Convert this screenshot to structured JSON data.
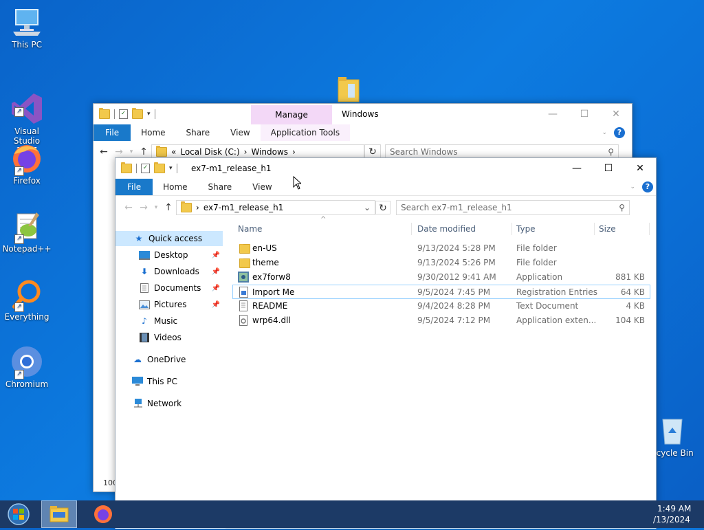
{
  "desktop": {
    "icons": [
      {
        "label": "This PC",
        "icon": "this-pc-icon"
      },
      {
        "label": "Visual Studio\n2017",
        "icon": "visual-studio-icon"
      },
      {
        "label": "Firefox",
        "icon": "firefox-icon"
      },
      {
        "label": "Notepad++",
        "icon": "notepad-plus-plus-icon"
      },
      {
        "label": "Everything",
        "icon": "everything-icon"
      },
      {
        "label": "Chromium",
        "icon": "chromium-icon"
      },
      {
        "label": "ecycle Bin",
        "icon": "recycle-bin-icon"
      }
    ]
  },
  "back_window": {
    "title": "Windows",
    "contextual_tab_group": "Manage",
    "tabs": [
      "File",
      "Home",
      "Share",
      "View",
      "Application Tools"
    ],
    "breadcrumb": {
      "prefix": "«",
      "items": [
        "Local Disk (C:)",
        "Windows"
      ]
    },
    "search_placeholder": "Search Windows",
    "status_fragment": "100"
  },
  "front_window": {
    "title": "ex7-m1_release_h1",
    "tabs": [
      "File",
      "Home",
      "Share",
      "View"
    ],
    "breadcrumb": {
      "items": [
        "ex7-m1_release_h1"
      ]
    },
    "search_placeholder": "Search ex7-m1_release_h1",
    "nav": {
      "quick_access": "Quick access",
      "pinned": [
        {
          "label": "Desktop",
          "icon": "desktop-icon",
          "pinned": true
        },
        {
          "label": "Downloads",
          "icon": "downloads-icon",
          "pinned": true
        },
        {
          "label": "Documents",
          "icon": "documents-icon",
          "pinned": true
        },
        {
          "label": "Pictures",
          "icon": "pictures-icon",
          "pinned": true
        },
        {
          "label": "Music",
          "icon": "music-icon",
          "pinned": false
        },
        {
          "label": "Videos",
          "icon": "videos-icon",
          "pinned": false
        }
      ],
      "onedrive": "OneDrive",
      "this_pc": "This PC",
      "network": "Network"
    },
    "columns": {
      "name": "Name",
      "date": "Date modified",
      "type": "Type",
      "size": "Size"
    },
    "files": [
      {
        "name": "en-US",
        "date": "9/13/2024 5:28 PM",
        "type": "File folder",
        "size": "",
        "icon": "folder-icon"
      },
      {
        "name": "theme",
        "date": "9/13/2024 5:26 PM",
        "type": "File folder",
        "size": "",
        "icon": "folder-icon"
      },
      {
        "name": "ex7forw8",
        "date": "9/30/2012 9:41 AM",
        "type": "Application",
        "size": "881 KB",
        "icon": "application-icon"
      },
      {
        "name": "Import Me",
        "date": "9/5/2024 7:45 PM",
        "type": "Registration Entries",
        "size": "64 KB",
        "icon": "registry-icon"
      },
      {
        "name": "README",
        "date": "9/4/2024 8:28 PM",
        "type": "Text Document",
        "size": "4 KB",
        "icon": "text-document-icon"
      },
      {
        "name": "wrp64.dll",
        "date": "9/5/2024 7:12 PM",
        "type": "Application exten...",
        "size": "104 KB",
        "icon": "dll-icon"
      }
    ]
  },
  "taskbar": {
    "time": "1:49 AM",
    "date": "/13/2024"
  }
}
